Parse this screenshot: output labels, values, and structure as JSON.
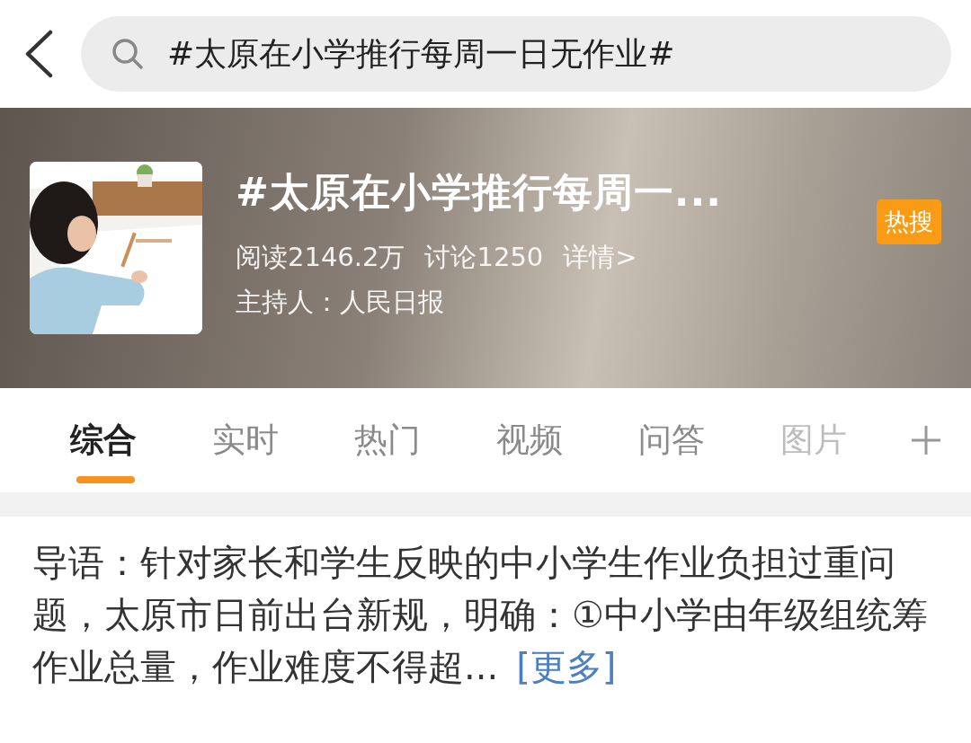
{
  "search": {
    "value": "#太原在小学推行每周一日无作业#"
  },
  "topic": {
    "title": "#太原在小学推行每周一...",
    "badge": "热搜",
    "stats": [
      "阅读2146.2万",
      "讨论1250"
    ],
    "details_link": "详情>",
    "host": "主持人：人民日报"
  },
  "tabs": [
    {
      "label": "综合",
      "selected": true
    },
    {
      "label": "实时",
      "selected": false
    },
    {
      "label": "热门",
      "selected": false
    },
    {
      "label": "视频",
      "selected": false
    },
    {
      "label": "问答",
      "selected": false
    },
    {
      "label": "图片",
      "selected": false
    }
  ],
  "intro": {
    "text": "导语：针对家长和学生反映的中小学生作业负担过重问题，太原市日前出台新规，明确：①中小学由年级组统筹作业总量，作业难度不得超...",
    "more_link": "[更多]"
  }
}
